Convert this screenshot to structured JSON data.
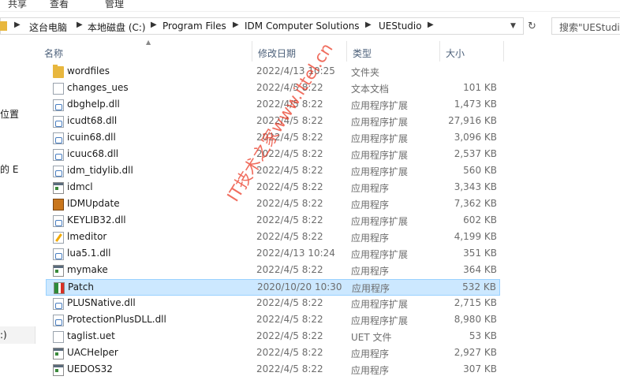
{
  "ribbon": {
    "share": "共享",
    "view": "查看",
    "manage": "管理"
  },
  "address": {
    "crumbs": [
      "这台电脑",
      "本地磁盘 (C:)",
      "Program Files",
      "IDM Computer Solutions",
      "UEStudio"
    ]
  },
  "search": {
    "placeholder": "搜索\"UEStudio"
  },
  "nav": {
    "item1": "位置",
    "item2": "的 E",
    "item3": ":)"
  },
  "headers": {
    "name": "名称",
    "date": "修改日期",
    "type": "类型",
    "size": "大小"
  },
  "files": [
    {
      "name": "wordfiles",
      "date": "2022/4/13 10:25",
      "type": "文件夹",
      "size": "",
      "icon": "folder-icon"
    },
    {
      "name": "changes_ues",
      "date": "2022/4/5 8:22",
      "type": "文本文档",
      "size": "101 KB",
      "icon": "text-file-icon"
    },
    {
      "name": "dbghelp.dll",
      "date": "2022/4/5 8:22",
      "type": "应用程序扩展",
      "size": "1,473 KB",
      "icon": "dll-icon"
    },
    {
      "name": "icudt68.dll",
      "date": "2022/4/5 8:22",
      "type": "应用程序扩展",
      "size": "27,916 KB",
      "icon": "dll-icon"
    },
    {
      "name": "icuin68.dll",
      "date": "2022/4/5 8:22",
      "type": "应用程序扩展",
      "size": "3,096 KB",
      "icon": "dll-icon"
    },
    {
      "name": "icuuc68.dll",
      "date": "2022/4/5 8:22",
      "type": "应用程序扩展",
      "size": "2,537 KB",
      "icon": "dll-icon"
    },
    {
      "name": "idm_tidylib.dll",
      "date": "2022/4/5 8:22",
      "type": "应用程序扩展",
      "size": "560 KB",
      "icon": "dll-icon"
    },
    {
      "name": "idmcl",
      "date": "2022/4/5 8:22",
      "type": "应用程序",
      "size": "3,343 KB",
      "icon": "exe-icon"
    },
    {
      "name": "IDMUpdate",
      "date": "2022/4/5 8:22",
      "type": "应用程序",
      "size": "7,362 KB",
      "icon": "update-icon"
    },
    {
      "name": "KEYLIB32.dll",
      "date": "2022/4/5 8:22",
      "type": "应用程序扩展",
      "size": "602 KB",
      "icon": "dll-icon"
    },
    {
      "name": "lmeditor",
      "date": "2022/4/5 8:22",
      "type": "应用程序",
      "size": "4,199 KB",
      "icon": "editor-icon"
    },
    {
      "name": "lua5.1.dll",
      "date": "2022/4/13 10:24",
      "type": "应用程序扩展",
      "size": "351 KB",
      "icon": "dll-icon"
    },
    {
      "name": "mymake",
      "date": "2022/4/5 8:22",
      "type": "应用程序",
      "size": "364 KB",
      "icon": "exe-icon"
    },
    {
      "name": "Patch",
      "date": "2020/10/20 10:30",
      "type": "应用程序",
      "size": "532 KB",
      "icon": "patch-icon",
      "selected": true
    },
    {
      "name": "PLUSNative.dll",
      "date": "2022/4/5 8:22",
      "type": "应用程序扩展",
      "size": "2,715 KB",
      "icon": "dll-icon"
    },
    {
      "name": "ProtectionPlusDLL.dll",
      "date": "2022/4/5 8:22",
      "type": "应用程序扩展",
      "size": "8,980 KB",
      "icon": "dll-icon"
    },
    {
      "name": "taglist.uet",
      "date": "2022/4/5 8:22",
      "type": "UET 文件",
      "size": "53 KB",
      "icon": "file-icon"
    },
    {
      "name": "UACHelper",
      "date": "2022/4/5 8:22",
      "type": "应用程序",
      "size": "2,927 KB",
      "icon": "exe-icon"
    },
    {
      "name": "UEDOS32",
      "date": "2022/4/5 8:22",
      "type": "应用程序",
      "size": "307 KB",
      "icon": "exe-icon"
    }
  ],
  "watermark": "IT技术之家www.ittel.cn",
  "colors": {
    "selection_bg": "#cce8ff",
    "selection_border": "#99d1ff",
    "header_text": "#4c607a",
    "watermark": "#eb3c28"
  }
}
